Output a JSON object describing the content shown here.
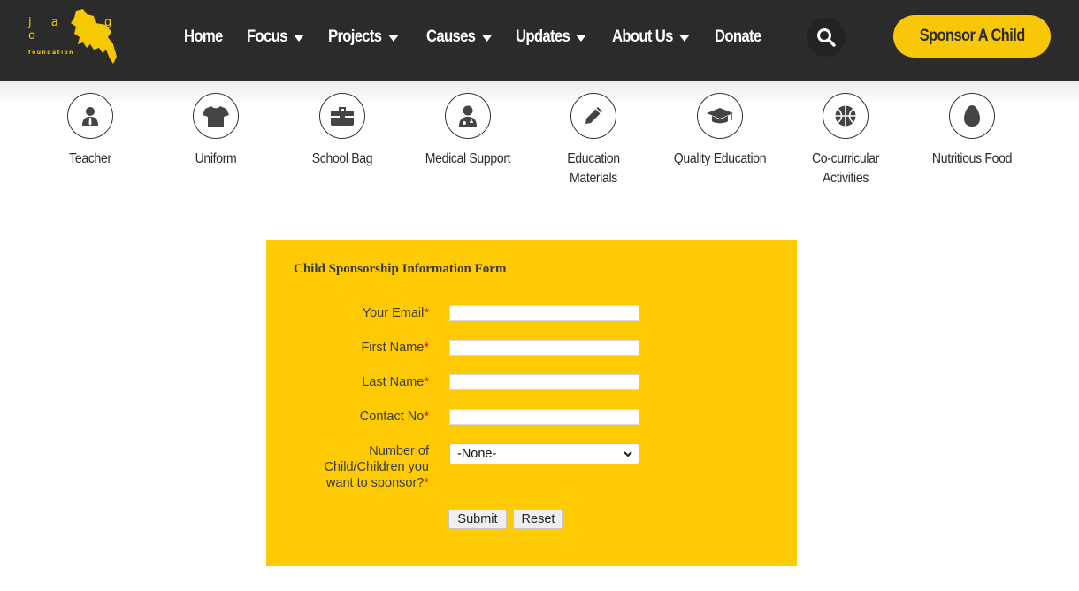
{
  "brand": {
    "logo_letters": "j a a g o",
    "logo_sub": "foundation",
    "accent": "#f8c808",
    "dark": "#2b2b2b"
  },
  "nav": {
    "items": [
      {
        "label": "Home",
        "dropdown": false
      },
      {
        "label": "Focus",
        "dropdown": true
      },
      {
        "label": "Projects",
        "dropdown": true
      },
      {
        "label": "Causes",
        "dropdown": true
      },
      {
        "label": "Updates",
        "dropdown": true
      },
      {
        "label": "About Us",
        "dropdown": true
      },
      {
        "label": "Donate",
        "dropdown": false
      }
    ],
    "search_icon": "search-icon",
    "cta_label": "Sponsor A Child"
  },
  "features": [
    {
      "label": "Teacher",
      "icon": "teacher-icon"
    },
    {
      "label": "Uniform",
      "icon": "tshirt-icon"
    },
    {
      "label": "School Bag",
      "icon": "briefcase-icon"
    },
    {
      "label": "Medical Support",
      "icon": "doctor-icon"
    },
    {
      "label": "Education Materials",
      "icon": "pencil-icon"
    },
    {
      "label": "Quality Education",
      "icon": "graduation-cap-icon"
    },
    {
      "label": "Co-curricular Activities",
      "icon": "basketball-icon"
    },
    {
      "label": "Nutritious Food",
      "icon": "egg-icon"
    }
  ],
  "form": {
    "title": "Child Sponsorship Information Form",
    "fields": [
      {
        "label": "Your Email",
        "required_mark": "*",
        "value": ""
      },
      {
        "label": "First Name",
        "required_mark": "*",
        "value": ""
      },
      {
        "label": "Last Name",
        "required_mark": "*",
        "value": ""
      },
      {
        "label": "Contact No",
        "required_mark": "*",
        "value": ""
      }
    ],
    "children": {
      "label_line1": "Number of",
      "label_line2": "Child/Children you",
      "label_line3": "want to sponsor?",
      "required_mark": "*",
      "selected": "-None-"
    },
    "submit_label": "Submit",
    "reset_label": "Reset"
  }
}
